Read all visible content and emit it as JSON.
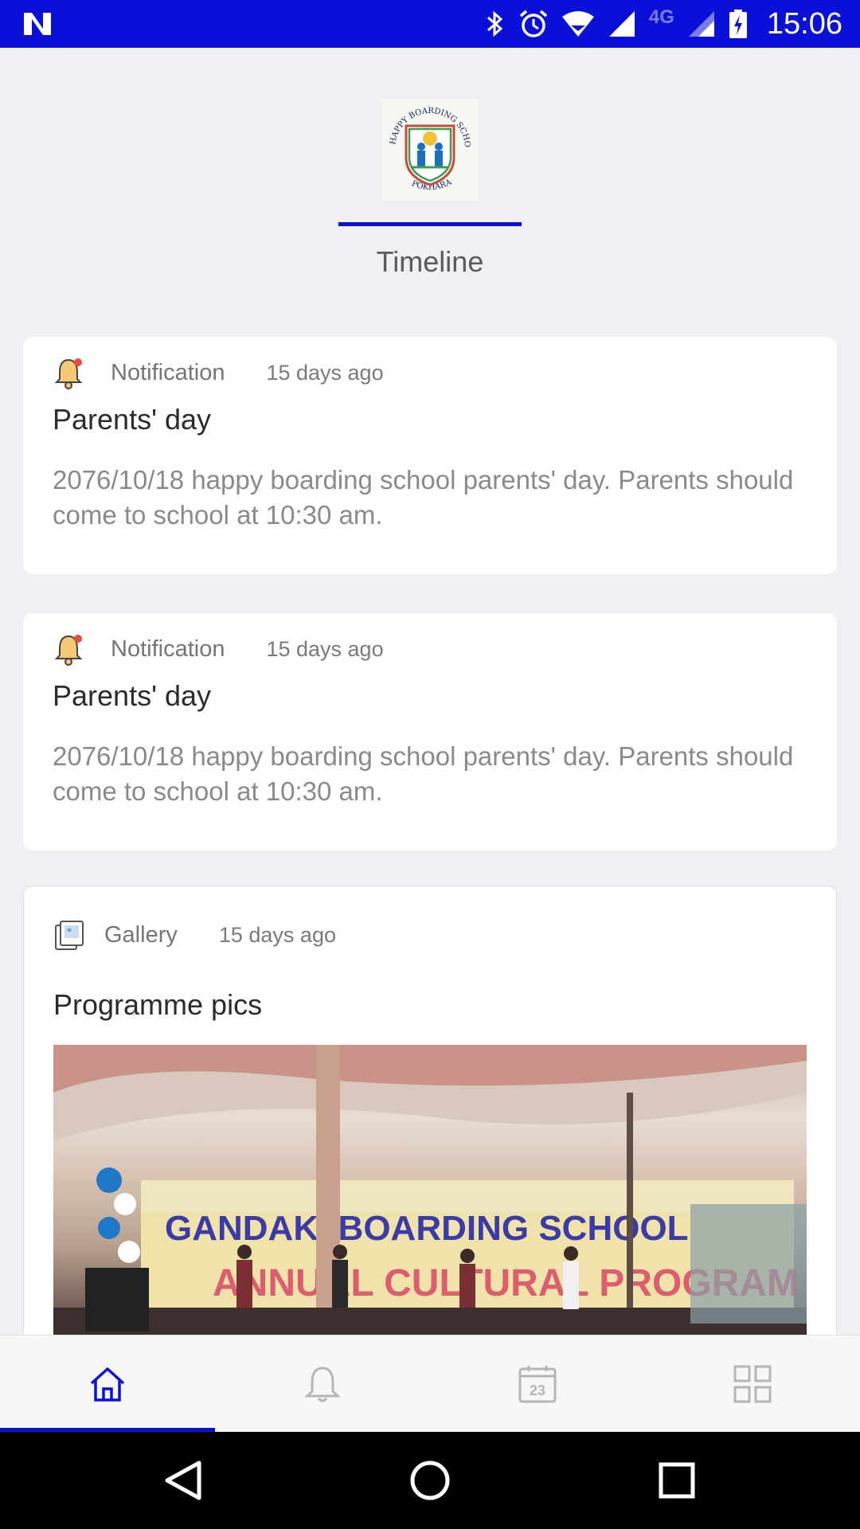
{
  "status_bar": {
    "time": "15:06",
    "network": "4G",
    "icons": [
      "notification-n-icon",
      "bluetooth-icon",
      "alarm-icon",
      "wifi-icon",
      "signal-icon",
      "signal-icon-2",
      "battery-charging-icon"
    ]
  },
  "header": {
    "logo": {
      "name": "school-logo",
      "top_text": "HAPPY BOARDING SCHOOL",
      "bottom_text": "POKHARA"
    },
    "active_tab": "Timeline"
  },
  "feed": [
    {
      "type": "Notification",
      "icon": "bell-icon",
      "time_ago": "15 days ago",
      "title": "Parents' day",
      "body": "2076/10/18 happy boarding school parents' day. Parents should come to school at 10:30 am."
    },
    {
      "type": "Notification",
      "icon": "bell-icon",
      "time_ago": "15 days ago",
      "title": "Parents' day",
      "body": "2076/10/18 happy boarding school parents' day. Parents should come to school at 10:30 am."
    },
    {
      "type": "Gallery",
      "icon": "gallery-icon",
      "time_ago": "15 days ago",
      "title": "Programme pics",
      "photo": {
        "banner_text": "GANDAKI BOARDING SCHOOL",
        "banner_subtext": "ANNUAL CULTURAL PROGRAM"
      }
    }
  ],
  "bottom_nav": {
    "items": [
      {
        "name": "home",
        "icon": "home-icon",
        "active": true
      },
      {
        "name": "notifications",
        "icon": "bell-outline-icon",
        "active": false
      },
      {
        "name": "calendar",
        "icon": "calendar-icon",
        "label": "23",
        "active": false
      },
      {
        "name": "menu",
        "icon": "grid-icon",
        "active": false
      }
    ]
  },
  "colors": {
    "accent": "#0a10d8",
    "background": "#efeff4",
    "card": "#ffffff",
    "text_primary": "#2b2b2b",
    "text_secondary": "#8a8a8a"
  }
}
